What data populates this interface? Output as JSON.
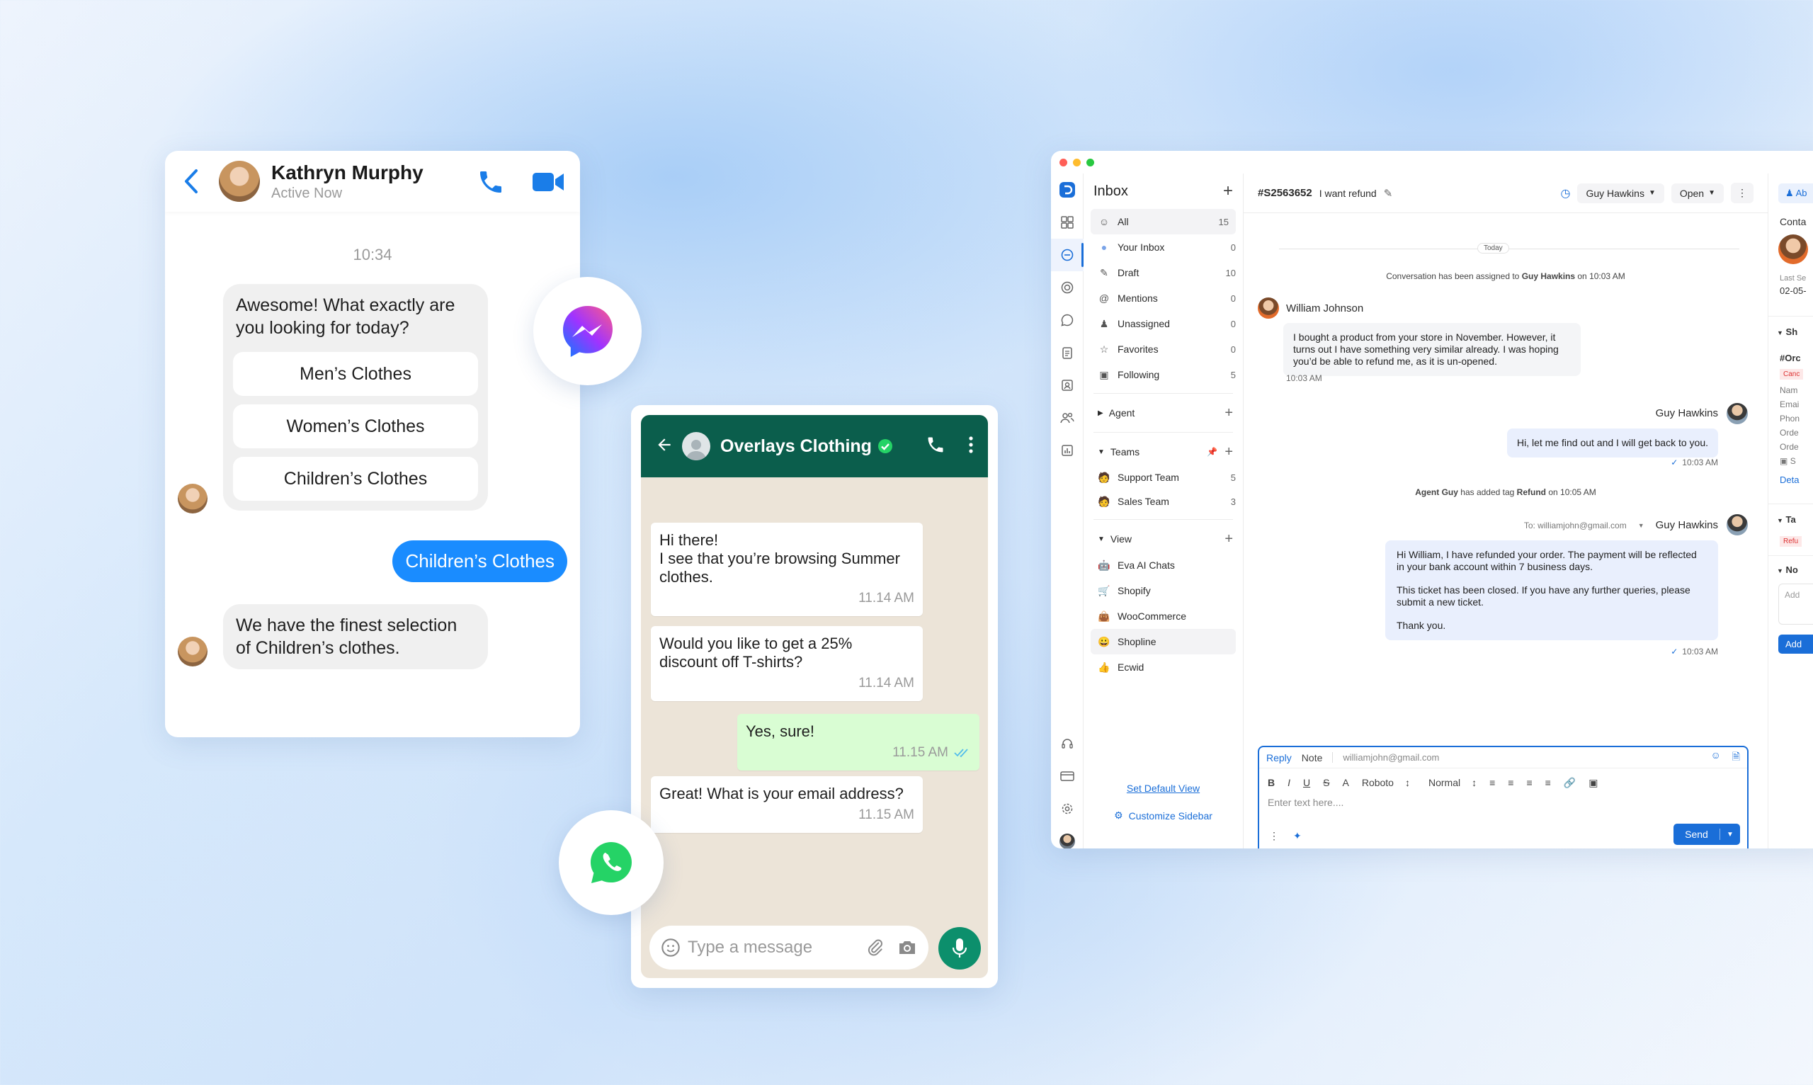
{
  "messenger": {
    "contact_name": "Kathryn Murphy",
    "contact_status": "Active Now",
    "time": "10:34",
    "bot_question": "Awesome! What exactly are you looking for today?",
    "options": [
      "Men’s Clothes",
      "Women’s Clothes",
      "Children’s Clothes"
    ],
    "user_reply": "Children’s Clothes",
    "bot_reply": "We have the finest selection of Children’s clothes."
  },
  "whatsapp": {
    "business_name": "Overlays Clothing",
    "messages": [
      {
        "text": "Hi there!\nI see that you’re browsing Summer clothes.",
        "time": "11.14 AM",
        "out": false
      },
      {
        "text": "Would you like to get a 25% discount off T-shirts?",
        "time": "11.14 AM",
        "out": false
      },
      {
        "text": "Yes, sure!",
        "time": "11.15 AM",
        "out": true
      },
      {
        "text": "Great! What is your email address?",
        "time": "11.15 AM",
        "out": false
      }
    ],
    "input_placeholder": "Type a message"
  },
  "app": {
    "sidebar": {
      "title": "Inbox",
      "items": [
        {
          "label": "All",
          "count": "15"
        },
        {
          "label": "Your Inbox",
          "count": "0"
        },
        {
          "label": "Draft",
          "count": "10"
        },
        {
          "label": "Mentions",
          "count": "0"
        },
        {
          "label": "Unassigned",
          "count": "0"
        },
        {
          "label": "Favorites",
          "count": "0"
        },
        {
          "label": "Following",
          "count": "5"
        }
      ],
      "agent_label": "Agent",
      "teams_label": "Teams",
      "teams": [
        {
          "label": "Support Team",
          "count": "5"
        },
        {
          "label": "Sales Team",
          "count": "3"
        }
      ],
      "view_label": "View",
      "views": [
        "Eva AI Chats",
        "Shopify",
        "WooCommerce",
        "Shopline",
        "Ecwid"
      ],
      "set_default_view": "Set Default View",
      "customize_sidebar": "Customize Sidebar"
    },
    "ticket": {
      "id": "#S2563652",
      "subject": "I want refund",
      "assignee": "Guy Hawkins",
      "status": "Open",
      "today": "Today",
      "assigned_prefix": "Conversation has been assigned to ",
      "assigned_name": "Guy Hawkins",
      "assigned_suffix": " on 10:03  AM",
      "customer_name": "William Johnson",
      "customer_msg": "I bought a product from your store in November. However, it turns out I have something very similar already. I was hoping you’d be able to refund me, as it is un-opened.",
      "customer_time": "10:03 AM",
      "agent_name": "Guy Hawkins",
      "agent_msg1": "Hi, let me find out and I will get back to you.",
      "agent_time1": "10:03 AM",
      "tag_prefix": "Agent Guy",
      "tag_middle": " has added tag ",
      "tag_name": "Refund",
      "tag_suffix": " on 10:05 AM",
      "to_email": "To: williamjohn@gmail.com",
      "agent_msg2_p1": "Hi William, I have refunded your order. The payment will be reflected in your bank account within 7 business days.",
      "agent_msg2_p2": "This ticket has been closed. If you have any further queries, please submit a new ticket.",
      "agent_msg2_p3": "Thank you.",
      "agent_time2": "10:03 AM"
    },
    "composer": {
      "tab_reply": "Reply",
      "tab_note": "Note",
      "email": "williamjohn@gmail.com",
      "font": "Roboto",
      "size": "Normal",
      "placeholder": "Enter text here....",
      "send": "Send"
    },
    "right_panel": {
      "top_btn": "Ab",
      "contact": "Conta",
      "last_seen": "Last Se",
      "date": "02-05-",
      "section1": "Sh",
      "order": "#Orc",
      "cancelled": "Canc",
      "fields": [
        "Nam",
        "Emai",
        "Phon",
        "Orde",
        "Orde",
        "S"
      ],
      "details": "Deta",
      "section2": "Ta",
      "tag": "Refu",
      "section3": "No",
      "add_placeholder": "Add",
      "add_btn": "Add"
    }
  }
}
